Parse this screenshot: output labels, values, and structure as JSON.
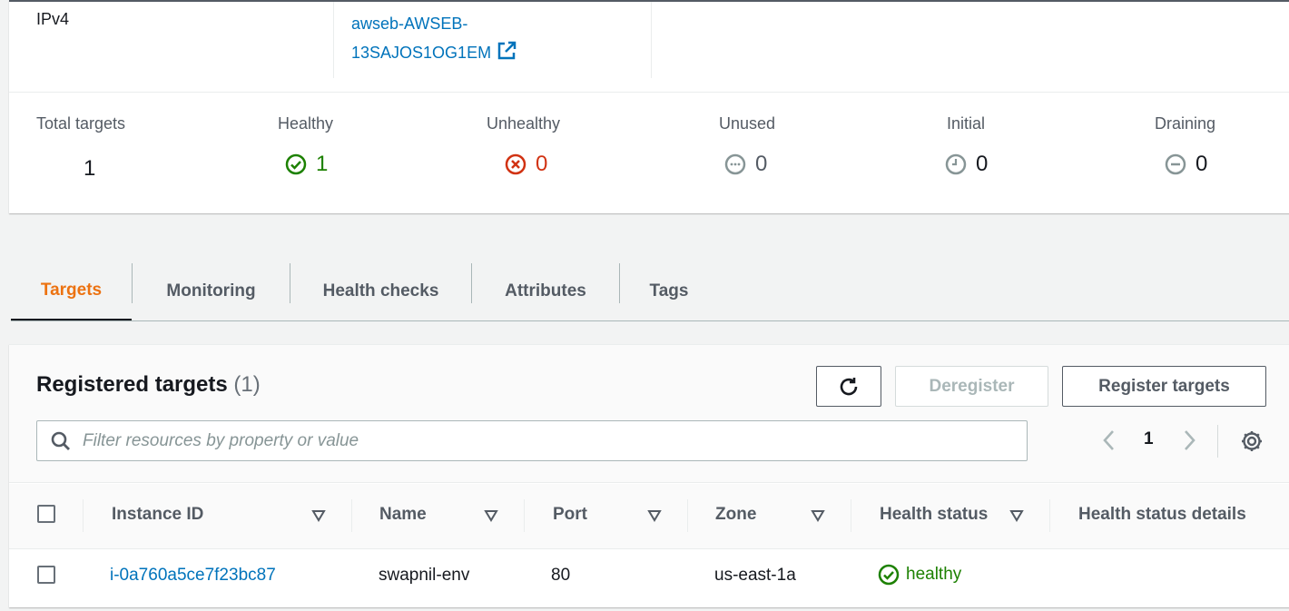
{
  "target_group": {
    "ip_address_type": "IPv4",
    "load_balancer_line1": "awseb-AWSEB-",
    "load_balancer_line2": "13SAJOS1OG1EM"
  },
  "stats": {
    "total": {
      "label": "Total targets",
      "value": "1"
    },
    "healthy": {
      "label": "Healthy",
      "value": "1",
      "icon": "check-circle-icon",
      "color": "#1d8102"
    },
    "unhealthy": {
      "label": "Unhealthy",
      "value": "0",
      "icon": "x-circle-icon",
      "color": "#d13212"
    },
    "unused": {
      "label": "Unused",
      "value": "0",
      "icon": "ellipsis-circle-icon",
      "color": "#879596"
    },
    "initial": {
      "label": "Initial",
      "value": "0",
      "icon": "clock-icon",
      "color": "#879596"
    },
    "draining": {
      "label": "Draining",
      "value": "0",
      "icon": "minus-circle-icon",
      "color": "#879596"
    }
  },
  "tabs": [
    {
      "label": "Targets",
      "active": true
    },
    {
      "label": "Monitoring",
      "active": false
    },
    {
      "label": "Health checks",
      "active": false
    },
    {
      "label": "Attributes",
      "active": false
    },
    {
      "label": "Tags",
      "active": false
    }
  ],
  "registered_targets": {
    "title": "Registered targets",
    "count": "(1)",
    "deregister_label": "Deregister",
    "register_label": "Register targets",
    "search_placeholder": "Filter resources by property or value",
    "current_page": "1",
    "columns": [
      "Instance ID",
      "Name",
      "Port",
      "Zone",
      "Health status",
      "Health status details"
    ],
    "rows": [
      {
        "instance_id": "i-0a760a5ce7f23bc87",
        "name": "swapnil-env",
        "port": "80",
        "zone": "us-east-1a",
        "health_status": "healthy",
        "health_status_details": ""
      }
    ]
  },
  "colors": {
    "accent": "#ec7211",
    "link": "#0073bb",
    "success": "#1d8102",
    "error": "#d13212"
  }
}
